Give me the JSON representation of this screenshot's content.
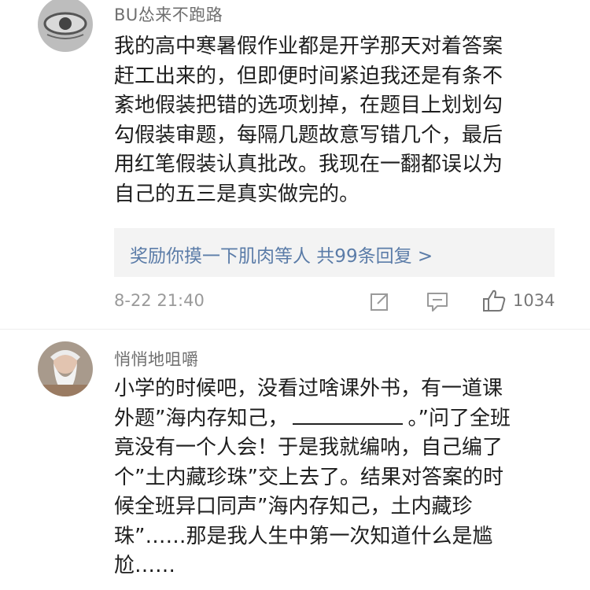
{
  "comments": [
    {
      "username": "BU怂来不跑路",
      "body_lines": [
        "我的高中寒暑假作业都是开学那天对着答案",
        "赶工出来的，但即便时间紧迫我还是有条不",
        "紊地假装把错的选项划掉，在题目上划划勾",
        "勾假装审题，每隔几题故意写错几个，最后",
        "用红笔假装认真批改。我现在一翻都误以为",
        "自己的五三是真实做完的。"
      ],
      "reply_preview": "奖励你摸一下肌肉等人  共99条回复 >",
      "timestamp": "8-22 21:40",
      "like_count": "1034"
    },
    {
      "username": "悄悄地咀嚼",
      "body_line1": "小学的时候吧，没看过啥课外书，有一道课",
      "body_line2_prefix": "外题”海内存知己，",
      "body_line2_suffix": "。”问了全班",
      "body_lines_rest": [
        "竟没有一个人会！于是我就编呐，自己编了",
        "个”土内藏珍珠”交上去了。结果对答案的时",
        "候全班异口同声”海内存知己，土内藏珍",
        "珠”……那是我人生中第一次知道什么是尴",
        "尬……"
      ]
    }
  ],
  "colors": {
    "reply_link": "#5b7ca8",
    "meta_gray": "#9a9a9a",
    "reply_bg": "#f3f3f3"
  },
  "icons": [
    "share-icon",
    "comment-icon",
    "like-icon"
  ]
}
